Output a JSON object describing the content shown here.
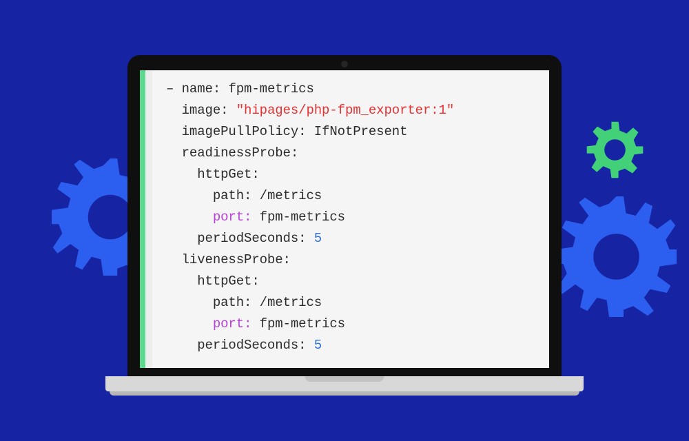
{
  "code": {
    "line1_key": "name:",
    "line1_val": "fpm-metrics",
    "line2_key": "image:",
    "line2_val": "\"hipages/php-fpm_exporter:1\"",
    "line3_key": "imagePullPolicy:",
    "line3_val": "IfNotPresent",
    "line4_key": "readinessProbe:",
    "line5_key": "httpGet:",
    "line6_key": "path:",
    "line6_val": "/metrics",
    "line7_key": "port:",
    "line7_val": "fpm-metrics",
    "line8_key": "periodSeconds:",
    "line8_val": "5",
    "line9_key": "livenessProbe:",
    "line10_key": "httpGet:",
    "line11_key": "path:",
    "line11_val": "/metrics",
    "line12_key": "port:",
    "line12_val": "fpm-metrics",
    "line13_key": "periodSeconds:",
    "line13_val": "5"
  },
  "colors": {
    "bg": "#1624a3",
    "gear_blue": "#2c5ef0",
    "gear_green": "#42d078",
    "string": "#e83232",
    "keyword": "#b840d8",
    "number": "#2b6fd8"
  }
}
